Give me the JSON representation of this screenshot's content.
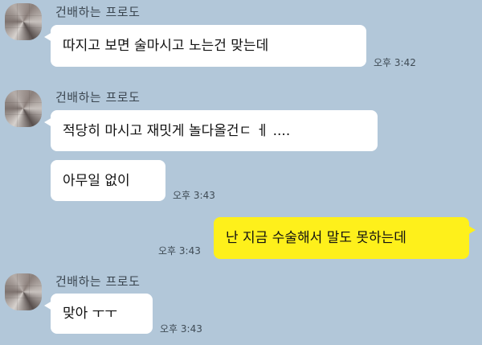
{
  "colors": {
    "background": "#b2c7d9",
    "incoming_bubble": "#ffffff",
    "outgoing_bubble": "#fef01b"
  },
  "messages": [
    {
      "sender": "건배하는 프로도",
      "text": "따지고 보면 술마시고 노는건 맞는데",
      "time": "오후 3:42"
    },
    {
      "sender": "건배하는 프로도",
      "text": "적당히 마시고 재밋게 놀다올건ㄷ ㅔ ...."
    },
    {
      "text": "아무일 없이",
      "time": "오후 3:43"
    },
    {
      "text": "난 지금 수술해서 말도 못하는데",
      "time": "오후 3:43",
      "mine": true
    },
    {
      "sender": "건배하는 프로도",
      "text": "맞아 ㅜㅜ",
      "time": "오후 3:43"
    }
  ]
}
